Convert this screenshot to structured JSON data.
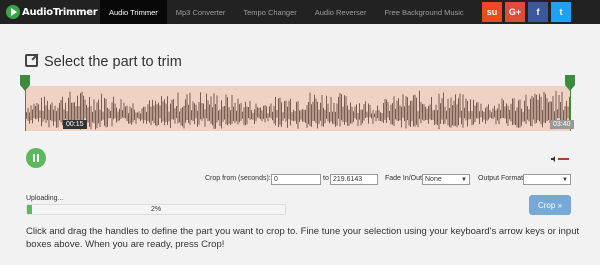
{
  "nav": {
    "logo": "AudioTrimmer",
    "items": [
      {
        "label": "Audio Trimmer",
        "active": true
      },
      {
        "label": "Mp3 Converter",
        "active": false
      },
      {
        "label": "Tempo Changer",
        "active": false
      },
      {
        "label": "Audio Reverser",
        "active": false
      },
      {
        "label": "Free Background Music",
        "active": false
      }
    ],
    "social": [
      {
        "name": "stumbleupon-icon",
        "glyph": "su",
        "color": "#eb4924"
      },
      {
        "name": "google-plus-icon",
        "glyph": "G+",
        "color": "#dd4b39"
      },
      {
        "name": "facebook-icon",
        "glyph": "f",
        "color": "#3b5998"
      },
      {
        "name": "twitter-icon",
        "glyph": "t",
        "color": "#1da1f2"
      }
    ]
  },
  "title": "Select the part to trim",
  "waveform": {
    "start_time": "00:15",
    "end_time": "03:40",
    "fill_color": "#f0d2c4",
    "wave_color": "#7a5c50"
  },
  "controls": {
    "crop_from_label": "Crop from (seconds):",
    "crop_from_value": "0",
    "to_label": "to",
    "crop_to_value": "219.6143",
    "fade_label": "Fade In/Out",
    "fade_value": "None",
    "format_label": "Output Format",
    "format_value": ""
  },
  "upload": {
    "label": "Uploading...",
    "percent_text": "2%",
    "progress": 0.02
  },
  "crop_button": "Crop »",
  "instructions": "Click and drag the handles to define the part you want to crop to. Fine tune your selection using your keyboard's arrow keys or input boxes above. When you are ready, press Crop!",
  "colors": {
    "accent_green": "#5cb85c",
    "crop_button": "#78a9d6",
    "nav_bg": "#222222"
  }
}
